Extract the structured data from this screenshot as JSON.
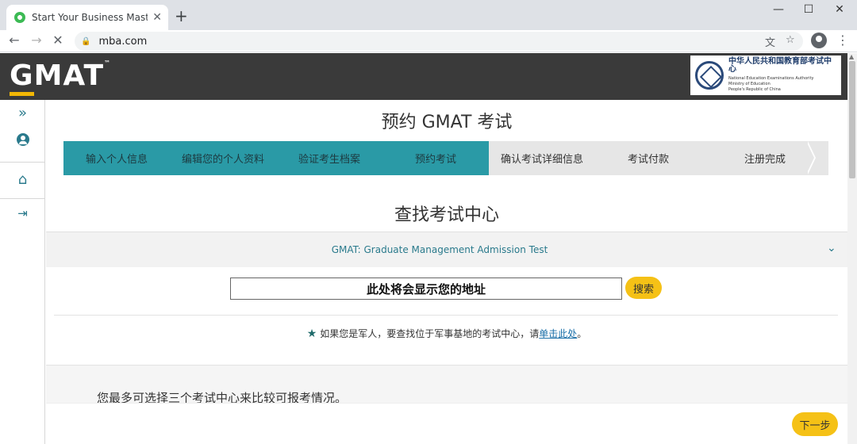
{
  "browser": {
    "tab_title": "Start Your Business Master's a",
    "tab_close": "✕",
    "new_tab": "+",
    "url": "mba.com",
    "win_min": "—",
    "win_max": "☐",
    "win_close": "✕"
  },
  "header": {
    "logo_g": "G",
    "logo_rest": "MAT",
    "logo_tm": "™",
    "neea_cn": "中华人民共和国教育部考试中心",
    "neea_en": [
      "National Education Examinations Authority",
      "Ministry of Education",
      "People's Republic of China"
    ]
  },
  "page": {
    "title": "预约 GMAT 考试",
    "steps": [
      {
        "label": "输入个人信息",
        "state": "done"
      },
      {
        "label": "编辑您的个人资料",
        "state": "done"
      },
      {
        "label": "验证考生档案",
        "state": "done"
      },
      {
        "label": "预约考试",
        "state": "done"
      },
      {
        "label": "确认考试详细信息",
        "state": "todo"
      },
      {
        "label": "考试付款",
        "state": "todo"
      },
      {
        "label": "注册完成",
        "state": "todo"
      }
    ],
    "find_title": "查找考试中心",
    "exam_name": "GMAT: Graduate Management Admission Test",
    "address_value": "此处将会显示您的地址",
    "search_label": "搜索",
    "military_text": "如果您是军人，要查找位于军事基地的考试中心，请",
    "military_link": "单击此处",
    "military_end": "。",
    "compare_text": "您最多可选择三个考试中心来比较可报考情况。",
    "next_label": "下一步"
  },
  "colors": {
    "teal": "#2a9aa6",
    "gray_step": "#e6e6e6",
    "yellow": "#f5c116",
    "header": "#3a3a3a"
  }
}
